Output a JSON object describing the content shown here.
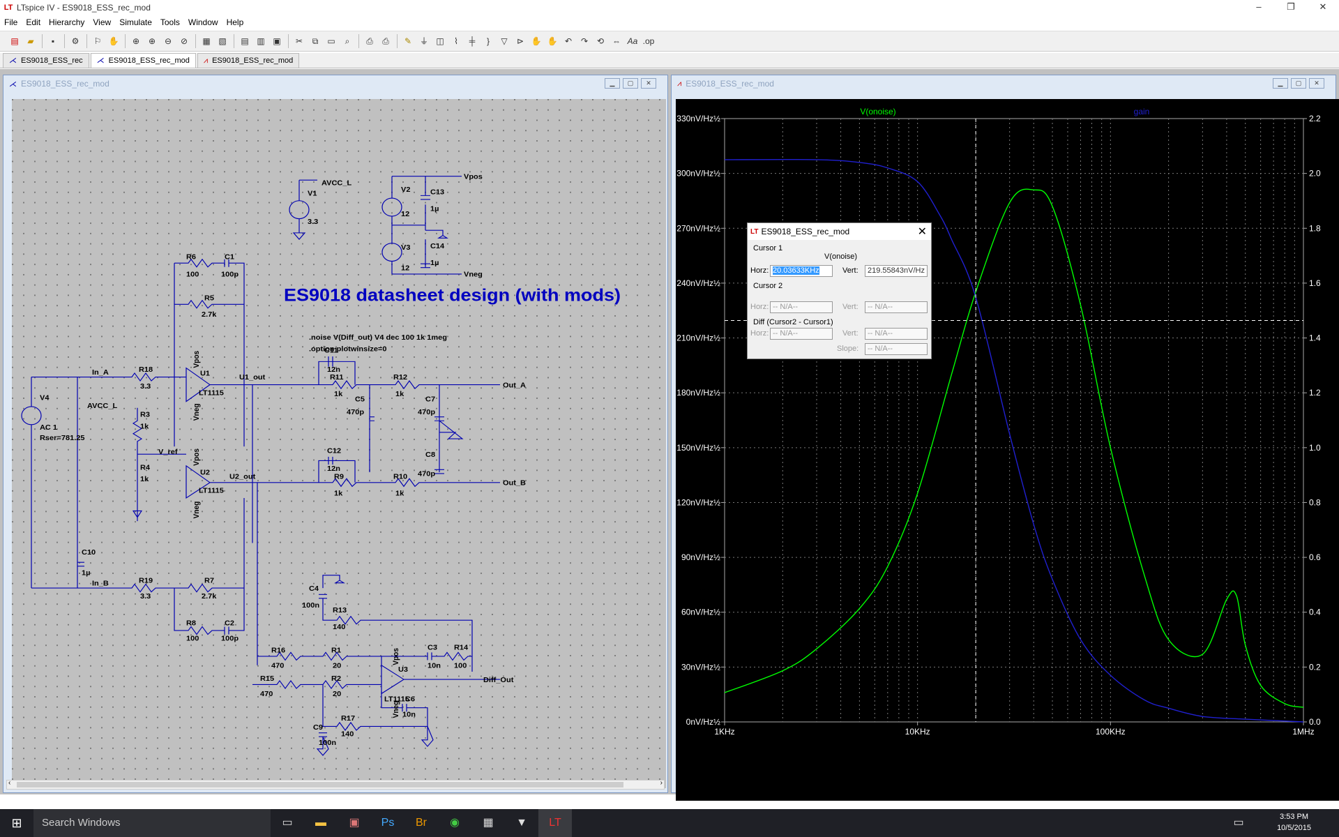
{
  "window": {
    "title": "LTspice IV - ES9018_ESS_rec_mod",
    "controls": [
      "–",
      "❐",
      "✕"
    ]
  },
  "menu": [
    "File",
    "Edit",
    "Hierarchy",
    "View",
    "Simulate",
    "Tools",
    "Window",
    "Help"
  ],
  "tabs": [
    {
      "label": "ES9018_ESS_rec",
      "icon": "schematic-icon",
      "active": false
    },
    {
      "label": "ES9018_ESS_rec_mod",
      "icon": "schematic-icon",
      "active": true
    },
    {
      "label": "ES9018_ESS_rec_mod",
      "icon": "waveform-icon",
      "active": false
    }
  ],
  "schematic": {
    "window_title": "ES9018_ESS_rec_mod",
    "heading": "ES9018 datasheet design (with mods)",
    "directives": [
      ".noise V(Diff_out) V4 dec 100 1k 1meg",
      ".option plotwinsize=0"
    ],
    "labels": {
      "avcc": "AVCC_L",
      "v1": "V1",
      "v1v": "3.3",
      "v2": "V2",
      "v2v": "12",
      "v3": "V3",
      "v3v": "12",
      "c13": "C13",
      "c13v": "1µ",
      "c14": "C14",
      "c14v": "1µ",
      "vpos": "Vpos",
      "vneg": "Vneg",
      "r6": "R6",
      "r6v": "100",
      "c1": "C1",
      "c1v": "100p",
      "r5": "R5",
      "r5v": "2.7k",
      "c11": "C11",
      "c11v": "12n",
      "r11": "R11",
      "r11v": "1k",
      "r12": "R12",
      "r12v": "1k",
      "in_a": "In_A",
      "r18": "R18",
      "r18v": "3.3",
      "u1": "U1",
      "u1m": "LT1115",
      "u1out": "U1_out",
      "out_a": "Out_A",
      "c5": "C5",
      "c5v": "470p",
      "c7": "C7",
      "c7v": "470p",
      "v4": "V4",
      "v4ac": "AC 1",
      "v4rser": "Rser=781.25",
      "avcc2": "AVCC_L",
      "r3": "R3",
      "r3v": "1k",
      "vref": "V_ref",
      "r4": "R4",
      "r4v": "1k",
      "c12": "C12",
      "c12v": "12n",
      "c8": "C8",
      "c8v": "470p",
      "u2": "U2",
      "u2m": "LT1115",
      "u2out": "U2_out",
      "r9": "R9",
      "r9v": "1k",
      "r10": "R10",
      "r10v": "1k",
      "out_b": "Out_B",
      "c10": "C10",
      "c10v": "1µ",
      "in_b": "In_B",
      "r19": "R19",
      "r19v": "3.3",
      "r7": "R7",
      "r7v": "2.7k",
      "r8": "R8",
      "r8v": "100",
      "c2": "C2",
      "c2v": "100p",
      "c4": "C4",
      "c4v": "100n",
      "r13": "R13",
      "r13v": "140",
      "r16": "R16",
      "r16v": "470",
      "r1": "R1",
      "r1v": "20",
      "c3": "C3",
      "c3v": "10n",
      "r14": "R14",
      "r14v": "100",
      "u3": "U3",
      "u3m": "LT1115",
      "diff_out": "Diff_Out",
      "r15": "R15",
      "r15v": "470",
      "r2": "R2",
      "r2v": "20",
      "c6": "C6",
      "c6v": "10n",
      "r17": "R17",
      "r17v": "140",
      "c9": "C9",
      "c9v": "100n",
      "vpos_pin": "Vpos",
      "vneg_pin": "Vneg"
    }
  },
  "plot": {
    "window_title": "ES9018_ESS_rec_mod",
    "trace_labels": [
      "V(onoise)",
      "gain"
    ],
    "colors": {
      "onoise": "#00ff00",
      "gain": "#2020d0",
      "grid": "#7a7a7a",
      "axis_text": "#ffffff"
    },
    "y_left_ticks": [
      "330nV/Hz½",
      "300nV/Hz½",
      "270nV/Hz½",
      "240nV/Hz½",
      "210nV/Hz½",
      "180nV/Hz½",
      "150nV/Hz½",
      "120nV/Hz½",
      "90nV/Hz½",
      "60nV/Hz½",
      "30nV/Hz½",
      "0nV/Hz½"
    ],
    "y_right_ticks": [
      "2.2",
      "2.0",
      "1.8",
      "1.6",
      "1.4",
      "1.2",
      "1.0",
      "0.8",
      "0.6",
      "0.4",
      "0.2",
      "0.0"
    ],
    "x_ticks": [
      "1KHz",
      "10KHz",
      "100KHz",
      "1MHz"
    ]
  },
  "chart_data": {
    "type": "line",
    "x_scale": "log",
    "xlim": [
      1000,
      1000000
    ],
    "ylim_left": [
      0,
      330
    ],
    "ylim_right": [
      0,
      2.2
    ],
    "series": [
      {
        "name": "V(onoise)",
        "axis": "left",
        "unit": "nV/Hz½",
        "x": [
          1000,
          2000,
          3000,
          5000,
          7000,
          10000,
          15000,
          20000,
          30000,
          40000,
          50000,
          70000,
          100000,
          150000,
          200000,
          300000,
          400000,
          450000,
          500000,
          600000,
          800000,
          1000000
        ],
        "y": [
          16,
          28,
          40,
          62,
          85,
          125,
          190,
          235,
          284,
          291,
          282,
          228,
          150,
          80,
          45,
          37,
          67,
          69,
          42,
          20,
          10,
          8
        ]
      },
      {
        "name": "gain",
        "axis": "right",
        "unit": "",
        "x": [
          1000,
          3000,
          5000,
          7000,
          10000,
          13000,
          15000,
          20000,
          30000,
          40000,
          50000,
          70000,
          100000,
          150000,
          200000,
          300000,
          500000,
          1000000
        ],
        "y": [
          2.05,
          2.05,
          2.04,
          2.02,
          1.97,
          1.85,
          1.76,
          1.55,
          1.05,
          0.72,
          0.52,
          0.3,
          0.17,
          0.08,
          0.05,
          0.02,
          0.01,
          0.0
        ]
      }
    ]
  },
  "cursor_dialog": {
    "title": "ES9018_ESS_rec_mod",
    "cursor1": "Cursor 1",
    "trace": "V(onoise)",
    "horz_label": "Horz:",
    "horz_value": "20.03633KHz",
    "vert_label": "Vert:",
    "vert_value": "219.55843nV/Hz",
    "cursor2": "Cursor 2",
    "na": "-- N/A--",
    "diff": "Diff (Cursor2 - Cursor1)",
    "slope_label": "Slope:"
  },
  "taskbar": {
    "search_placeholder": "Search Windows",
    "time": "3:53 PM",
    "date": "10/5/2015"
  }
}
